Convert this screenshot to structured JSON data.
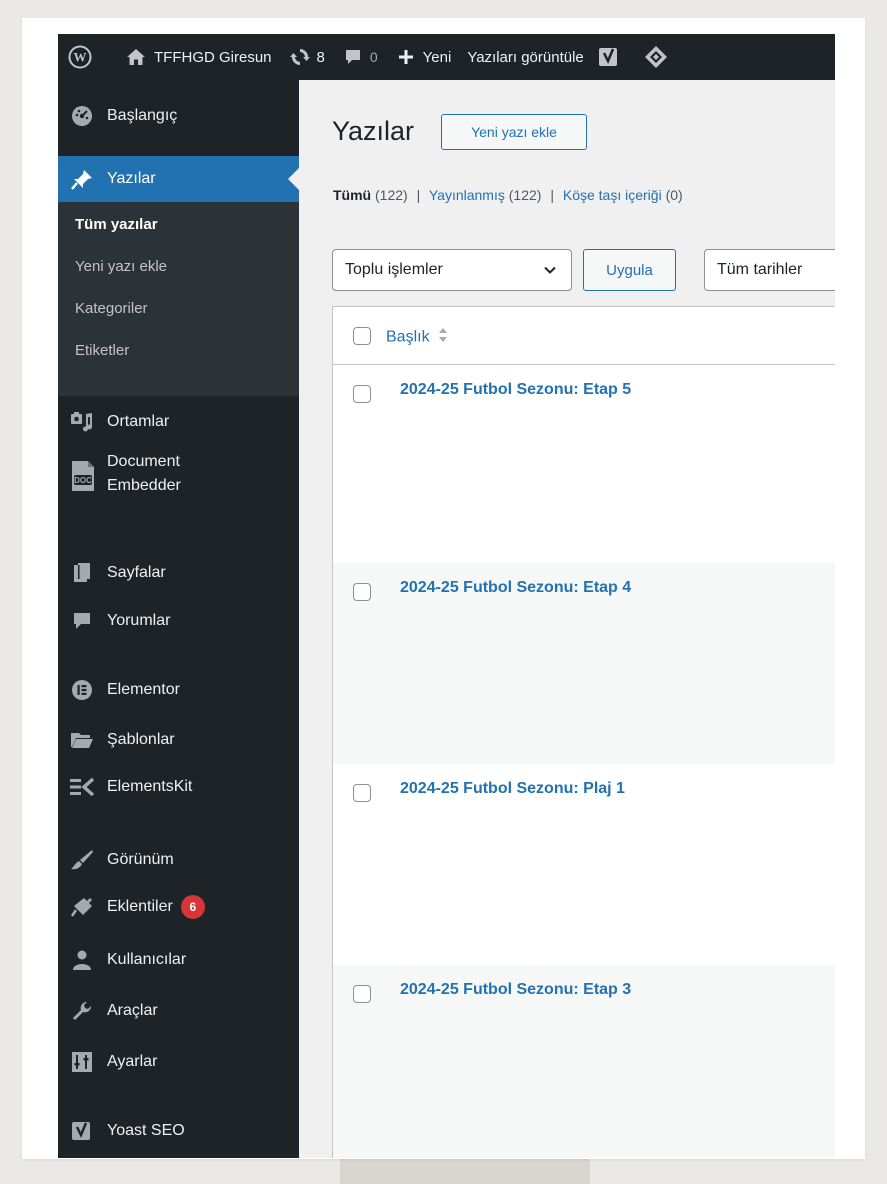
{
  "adminbar": {
    "logo_icon": "wordpress-icon",
    "site_name": "TFFHGD Giresun",
    "updates_count": "8",
    "comments_count": "0",
    "new_label": "Yeni",
    "view_posts_label": "Yazıları görüntüle"
  },
  "sidebar": {
    "items": [
      {
        "label": "Başlangıç",
        "icon": "dashboard-icon"
      },
      {
        "label": "Yazılar",
        "icon": "pin-icon"
      },
      {
        "label": "Ortamlar",
        "icon": "media-icon"
      },
      {
        "label_line1": "Document",
        "label_line2": "Embedder",
        "icon": "document-icon",
        "icon_text": "DOC"
      },
      {
        "label": "Sayfalar",
        "icon": "pages-icon"
      },
      {
        "label": "Yorumlar",
        "icon": "comments-icon"
      },
      {
        "label": "Elementor",
        "icon": "elementor-icon"
      },
      {
        "label": "Şablonlar",
        "icon": "folder-icon"
      },
      {
        "label": "ElementsKit",
        "icon": "elementskit-icon"
      },
      {
        "label": "Görünüm",
        "icon": "brush-icon"
      },
      {
        "label": "Eklentiler",
        "icon": "plugin-icon",
        "badge": "6"
      },
      {
        "label": "Kullanıcılar",
        "icon": "users-icon"
      },
      {
        "label": "Araçlar",
        "icon": "wrench-icon"
      },
      {
        "label": "Ayarlar",
        "icon": "settings-icon"
      },
      {
        "label": "Yoast SEO",
        "icon": "yoast-icon"
      }
    ],
    "submenu": [
      "Tüm yazılar",
      "Yeni yazı ekle",
      "Kategoriler",
      "Etiketler"
    ]
  },
  "main": {
    "title": "Yazılar",
    "add_new": "Yeni yazı ekle",
    "views": {
      "all": "Tümü",
      "all_count": "(122)",
      "published": "Yayınlanmış",
      "published_count": "(122)",
      "cornerstone": "Köşe taşı içeriği",
      "cornerstone_count": "(0)",
      "separator": "|"
    },
    "bulk_actions": "Toplu işlemler",
    "apply": "Uygula",
    "dates": "Tüm tarihler",
    "table_header": "Başlık",
    "rows": [
      "2024-25 Futbol Sezonu: Etap 5",
      "2024-25 Futbol Sezonu: Etap 4",
      "2024-25 Futbol Sezonu: Plaj 1",
      "2024-25 Futbol Sezonu: Etap 3"
    ]
  },
  "colors": {
    "admin_dark": "#1d2327",
    "accent": "#2271b1",
    "badge": "#d63638",
    "submenu_bg": "#2c3338"
  }
}
